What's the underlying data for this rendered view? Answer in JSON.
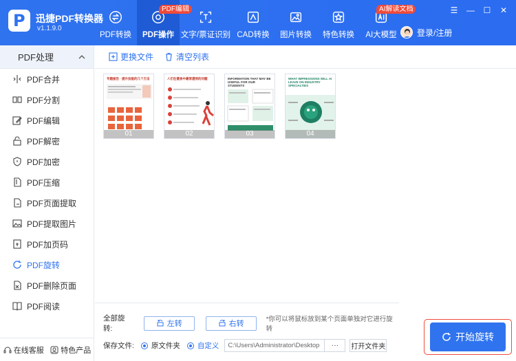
{
  "app": {
    "name": "迅捷PDF转换器",
    "version": "v1.1.9.0",
    "logo_letter": "P"
  },
  "nav": {
    "items": [
      {
        "label": "PDF转换",
        "icon": "pdf-convert-icon"
      },
      {
        "label": "PDF操作",
        "icon": "pdf-operate-icon",
        "badge": "PDF编辑"
      },
      {
        "label": "文字/票证识别",
        "icon": "ocr-icon"
      },
      {
        "label": "CAD转换",
        "icon": "cad-icon"
      },
      {
        "label": "图片转换",
        "icon": "image-icon"
      },
      {
        "label": "特色转换",
        "icon": "star-icon"
      },
      {
        "label": "AI大模型",
        "icon": "ai-icon",
        "badge": "AI解读文档"
      }
    ],
    "active_index": 1
  },
  "user": {
    "login_label": "登录/注册"
  },
  "sidebar": {
    "header": "PDF处理",
    "items": [
      {
        "label": "PDF合并",
        "icon": "merge-icon"
      },
      {
        "label": "PDF分割",
        "icon": "split-icon"
      },
      {
        "label": "PDF编辑",
        "icon": "edit-icon"
      },
      {
        "label": "PDF解密",
        "icon": "unlock-icon"
      },
      {
        "label": "PDF加密",
        "icon": "shield-icon"
      },
      {
        "label": "PDF压缩",
        "icon": "compress-icon"
      },
      {
        "label": "PDF页面提取",
        "icon": "extract-page-icon"
      },
      {
        "label": "PDF提取图片",
        "icon": "extract-image-icon"
      },
      {
        "label": "PDF加页码",
        "icon": "page-number-icon"
      },
      {
        "label": "PDF旋转",
        "icon": "rotate-icon"
      },
      {
        "label": "PDF删除页面",
        "icon": "delete-page-icon"
      },
      {
        "label": "PDF阅读",
        "icon": "read-icon"
      }
    ],
    "active_index": 9,
    "footer": {
      "service": "在线客服",
      "products": "特色产品"
    }
  },
  "toolbar": {
    "replace": "更换文件",
    "clear": "清空列表"
  },
  "pages": [
    {
      "num": "01",
      "title": "专题报告 · 提升技能的几个方法",
      "accent": "#e8643c"
    },
    {
      "num": "02",
      "title": "人们在健身中最常遇到的问题",
      "accent": "#d9413a"
    },
    {
      "num": "03",
      "title": "INFORMATION THAT MAY BE USEFUL FOR OUR STUDENTS",
      "accent": "#2f8f6a"
    },
    {
      "num": "04",
      "title": "WHAT IMPRESSIONS WILL AI LEAVE ON INDUSTRY SPECIALTIES",
      "accent": "#1f7f62"
    }
  ],
  "rotate": {
    "label": "全部旋转:",
    "left": "左转",
    "right": "右转",
    "hint": "*你可以将鼠标放到某个页面单独对它进行旋转"
  },
  "save": {
    "label": "保存文件:",
    "opt_original": "原文件夹",
    "opt_custom": "自定义",
    "path": "C:\\Users\\Administrator\\Desktop",
    "browse": "···",
    "open_folder": "打开文件夹"
  },
  "start": {
    "label": "开始旋转"
  },
  "colors": {
    "primary": "#2f73ef",
    "badge": "#f04a3a"
  }
}
